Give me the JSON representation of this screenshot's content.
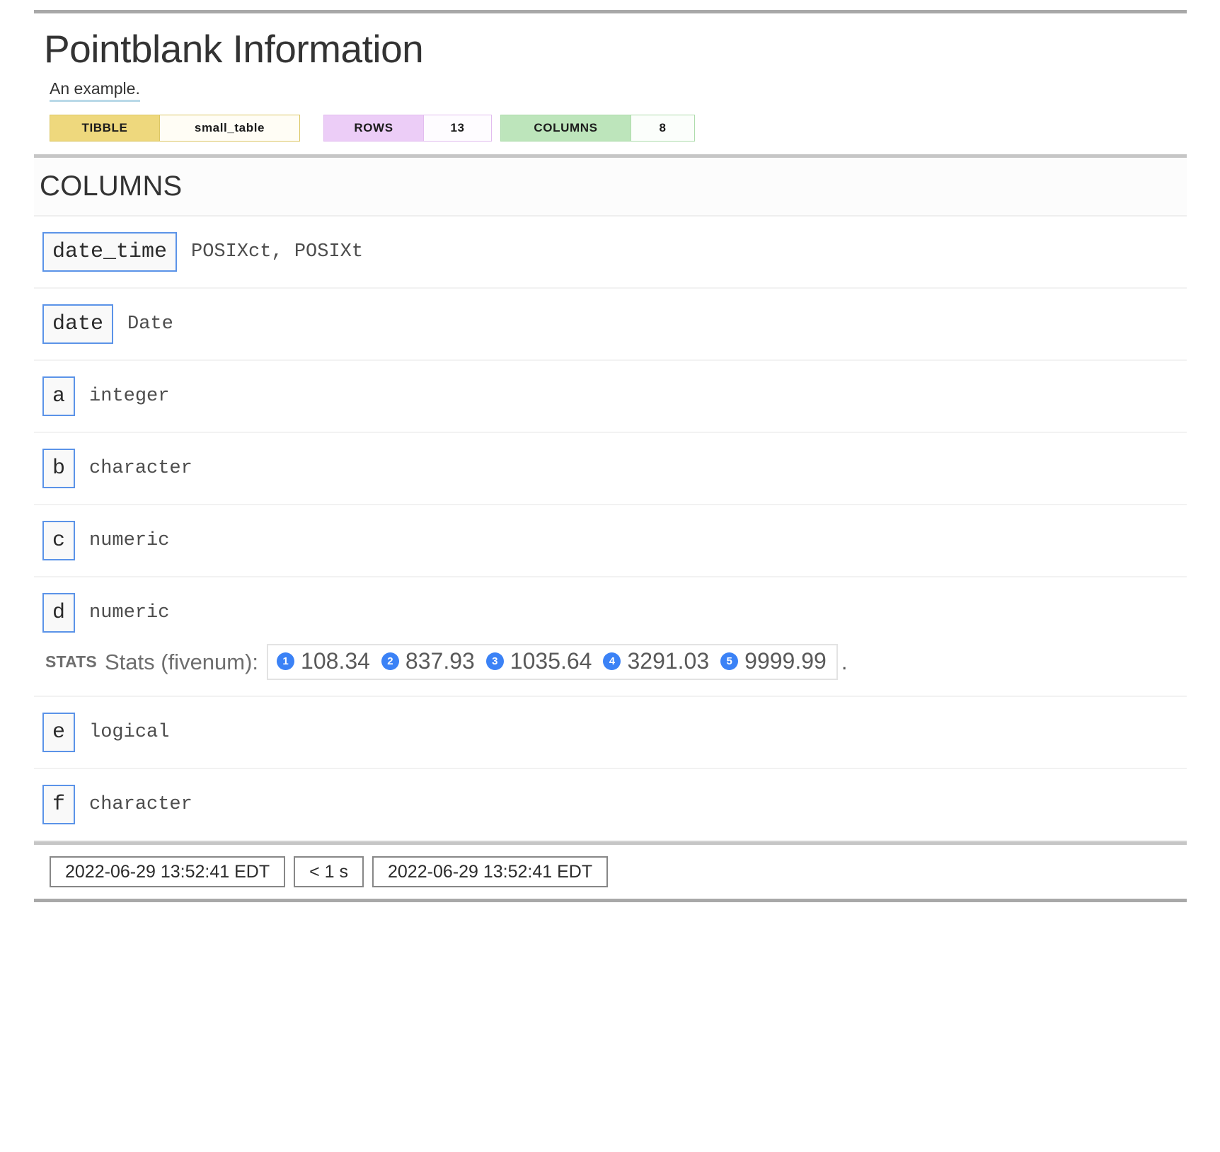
{
  "report": {
    "title": "Pointblank Information",
    "subtitle": "An example.",
    "badges": [
      {
        "label": "TIBBLE",
        "value": "small_table",
        "color": "#eed87d"
      },
      {
        "label": "ROWS",
        "value": "13",
        "color": "#eccdf7"
      },
      {
        "label": "COLUMNS",
        "value": "8",
        "color": "#bde5bb"
      }
    ]
  },
  "section": {
    "heading": "COLUMNS"
  },
  "columns": [
    {
      "name": "date_time",
      "type": "POSIXct, POSIXt"
    },
    {
      "name": "date",
      "type": "Date"
    },
    {
      "name": "a",
      "type": "integer"
    },
    {
      "name": "b",
      "type": "character"
    },
    {
      "name": "c",
      "type": "numeric"
    },
    {
      "name": "d",
      "type": "numeric",
      "stats": {
        "tag": "STATS",
        "label": "Stats (fivenum):",
        "values": [
          "108.34",
          "837.93",
          "1035.64",
          "3291.03",
          "9999.99"
        ],
        "trailing": "."
      }
    },
    {
      "name": "e",
      "type": "logical"
    },
    {
      "name": "f",
      "type": "character"
    }
  ],
  "footer": {
    "start_time": "2022-06-29 13:52:41 EDT",
    "duration": "< 1 s",
    "end_time": "2022-06-29 13:52:41 EDT"
  }
}
